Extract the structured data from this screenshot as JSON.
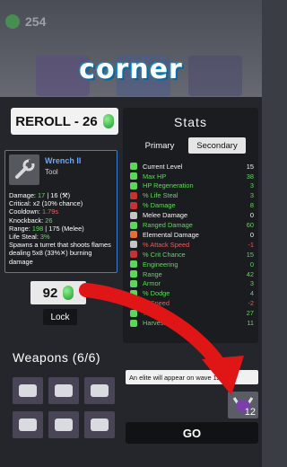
{
  "header": {
    "coins": "254",
    "title": "corner"
  },
  "reroll": {
    "label": "REROLL - 26"
  },
  "item": {
    "name": "Wrench II",
    "type": "Tool",
    "stats": [
      {
        "label": "Damage: ",
        "value": "17",
        "suffix": " | 16 (⚒)"
      },
      {
        "label": "Critical: ",
        "value": "x2",
        "suffix": " (10% chance)"
      },
      {
        "label": "Cooldown: ",
        "value": "1.79s",
        "suffix": ""
      },
      {
        "label": "Knockback: ",
        "value": "26",
        "suffix": ""
      },
      {
        "label": "Range: ",
        "value": "198",
        "suffix": " | 175 (Melee)"
      },
      {
        "label": "Life Steal: ",
        "value": "3%",
        "suffix": ""
      }
    ],
    "description": "Spawns a turret that shoots flames dealing 5x8 (33%✕) burning damage",
    "price": "92",
    "lock_label": "Lock"
  },
  "stats": {
    "title": "Stats",
    "tabs": [
      "Primary",
      "Secondary"
    ],
    "rows": [
      {
        "label": "Current Level",
        "value": "15",
        "color": "#ffffff",
        "icon": "level-icon",
        "icolor": "#5fe05a"
      },
      {
        "label": "Max HP",
        "value": "38",
        "color": "#5fe05a",
        "icon": "heart-icon",
        "icolor": "#5fe05a"
      },
      {
        "label": "HP Regeneration",
        "value": "3",
        "color": "#5fe05a",
        "icon": "regen-icon",
        "icolor": "#5fe05a"
      },
      {
        "label": "% Life Steal",
        "value": "3",
        "color": "#5fe05a",
        "icon": "lifesteal-icon",
        "icolor": "#c33"
      },
      {
        "label": "% Damage",
        "value": "8",
        "color": "#5fe05a",
        "icon": "damage-icon",
        "icolor": "#c33"
      },
      {
        "label": "Melee Damage",
        "value": "0",
        "color": "#ffffff",
        "icon": "melee-icon",
        "icolor": "#ccc"
      },
      {
        "label": "Ranged Damage",
        "value": "60",
        "color": "#5fe05a",
        "icon": "ranged-icon",
        "icolor": "#5fe05a"
      },
      {
        "label": "Elemental Damage",
        "value": "0",
        "color": "#ffffff",
        "icon": "elemental-icon",
        "icolor": "#f07030"
      },
      {
        "label": "% Attack Speed",
        "value": "-1",
        "color": "#ff5a5a",
        "icon": "attack-speed-icon",
        "icolor": "#ccc"
      },
      {
        "label": "% Crit Chance",
        "value": "15",
        "color": "#5fe05a",
        "icon": "crit-icon",
        "icolor": "#c33"
      },
      {
        "label": "Engineering",
        "value": "0",
        "color": "#5fe05a",
        "icon": "engineering-icon",
        "icolor": "#5fe05a"
      },
      {
        "label": "Range",
        "value": "42",
        "color": "#5fe05a",
        "icon": "range-icon",
        "icolor": "#5fe05a"
      },
      {
        "label": "Armor",
        "value": "3",
        "color": "#5fe05a",
        "icon": "armor-icon",
        "icolor": "#5fe05a"
      },
      {
        "label": "% Dodge",
        "value": "4",
        "color": "#5fe05a",
        "icon": "dodge-icon",
        "icolor": "#5fe05a"
      },
      {
        "label": "% Speed",
        "value": "-2",
        "color": "#ff5a5a",
        "icon": "speed-icon",
        "icolor": "#ccc"
      },
      {
        "label": "% Luck",
        "value": "27",
        "color": "#5fe05a",
        "icon": "luck-icon",
        "icolor": "#5fe05a"
      },
      {
        "label": "Harvesting",
        "value": "11",
        "color": "#5fe05a",
        "icon": "harvest-icon",
        "icolor": "#5fe05a"
      }
    ]
  },
  "weapons": {
    "title": "Weapons (6/6)"
  },
  "elite": {
    "message": "An elite will appear on wave 12",
    "wave": "12"
  },
  "go": {
    "label": "GO"
  }
}
